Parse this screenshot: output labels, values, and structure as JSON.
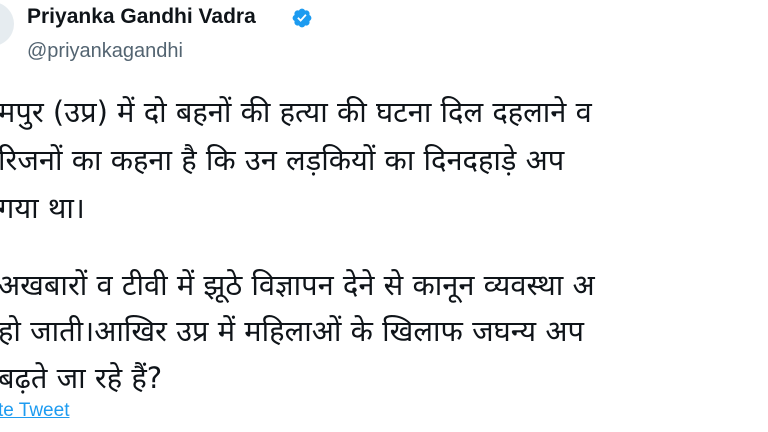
{
  "author": {
    "name": "Priyanka Gandhi Vadra",
    "handle": "@priyankagandhi",
    "verified_icon": "verified-badge-icon",
    "verified_color": "#1d9bf0"
  },
  "tweet": {
    "paragraph1": [
      "मपुर (उप्र) में दो बहनों की हत्या की घटना दिल दहलाने व",
      "रिजनों का कहना है कि उन लड़कियों का दिनदहाड़े अप",
      "गया था।"
    ],
    "paragraph2": [
      "अखबारों व टीवी में झूठे विज्ञापन देने से कानून व्यवस्था अ",
      "हो जाती।आखिर उप्र में महिलाओं के खिलाफ जघन्य अप",
      "बढ़ते जा रहे हैं?"
    ]
  },
  "actions": {
    "translate_label": "te Tweet"
  },
  "colors": {
    "text": "#0f1419",
    "secondary": "#536471",
    "link": "#1d9bf0"
  }
}
